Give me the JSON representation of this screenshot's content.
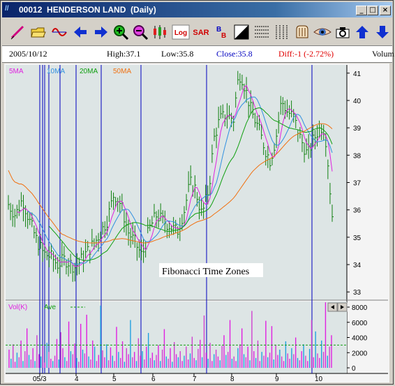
{
  "window": {
    "icon_text": "//",
    "title": "00012  HENDERSON LAND  (Daily)",
    "buttons": [
      "_",
      "□",
      "×"
    ]
  },
  "toolbar": [
    {
      "icon": "pen-icon"
    },
    {
      "icon": "open-folder-icon"
    },
    {
      "icon": "wave-icon"
    },
    {
      "icon": "arrow-left-icon"
    },
    {
      "icon": "arrow-right-icon"
    },
    {
      "icon": "zoom-in-icon"
    },
    {
      "icon": "zoom-out-icon"
    },
    {
      "icon": "candlestick-icon"
    },
    {
      "icon": "log-icon",
      "label": "Log"
    },
    {
      "icon": "sar-icon",
      "label": "SAR"
    },
    {
      "icon": "bollinger-icon",
      "label": "B"
    },
    {
      "icon": "contrast-icon"
    },
    {
      "icon": "grid-h-icon"
    },
    {
      "icon": "grid-v-icon"
    },
    {
      "icon": "stamp-icon"
    },
    {
      "icon": "eye-icon"
    },
    {
      "icon": "camera-icon"
    },
    {
      "icon": "arrow-up-icon"
    },
    {
      "icon": "arrow-down-icon"
    }
  ],
  "info": {
    "date": "2005/10/12",
    "high": "High:37.1",
    "low": "Low:35.8",
    "close": "Close:35.8",
    "diff": "Diff:-1  (-2.72%)",
    "volume": "Volum"
  },
  "colors": {
    "ma5": "#e020e0",
    "ma10": "#3090e0",
    "ma20": "#10a010",
    "ma50": "#f07010",
    "price": "#108010",
    "fib": "#0000c0",
    "chart_bg": "#dde5e5",
    "vol_avg": "#10a010"
  },
  "legend": [
    "5MA",
    "10MA",
    "20MA",
    "50MA"
  ],
  "annotation": "Fibonacci Time Zones",
  "vol_legend": {
    "label": "Vol(K)",
    "avg": "Ave"
  },
  "chart_data": [
    {
      "type": "line",
      "title": "00012 HENDERSON LAND (Daily)",
      "y_ticks": [
        "41",
        "40",
        "39",
        "38",
        "37",
        "36",
        "35",
        "34",
        "33"
      ],
      "ylim": [
        32.7,
        41.3
      ],
      "x_ticks": [
        "05/3",
        "4",
        "5",
        "6",
        "7",
        "8",
        "9",
        "10"
      ],
      "series": [
        {
          "name": "5MA"
        },
        {
          "name": "10MA"
        },
        {
          "name": "20MA"
        },
        {
          "name": "50MA"
        }
      ],
      "price_path": [
        [
          0,
          36.2
        ],
        [
          10,
          35.8
        ],
        [
          20,
          36.4
        ],
        [
          30,
          35.6
        ],
        [
          40,
          34.9
        ],
        [
          50,
          34.4
        ],
        [
          60,
          34.3
        ],
        [
          70,
          34.0
        ],
        [
          80,
          34.2
        ],
        [
          95,
          33.9
        ],
        [
          110,
          34.4
        ],
        [
          125,
          34.9
        ],
        [
          140,
          35.6
        ],
        [
          150,
          36.6
        ],
        [
          160,
          36.2
        ],
        [
          170,
          35.2
        ],
        [
          180,
          34.8
        ],
        [
          190,
          34.3
        ],
        [
          200,
          35.3
        ],
        [
          210,
          35.8
        ],
        [
          220,
          35.6
        ],
        [
          230,
          35.4
        ],
        [
          240,
          35.2
        ],
        [
          250,
          36.0
        ],
        [
          258,
          37.0
        ],
        [
          265,
          36.8
        ],
        [
          275,
          35.8
        ],
        [
          285,
          36.8
        ],
        [
          292,
          38.6
        ],
        [
          300,
          39.3
        ],
        [
          310,
          39.5
        ],
        [
          320,
          39.3
        ],
        [
          325,
          40.6
        ],
        [
          330,
          41.0
        ],
        [
          337,
          40.4
        ],
        [
          345,
          39.6
        ],
        [
          355,
          39.0
        ],
        [
          365,
          38.2
        ],
        [
          372,
          37.8
        ],
        [
          380,
          38.6
        ],
        [
          388,
          40.0
        ],
        [
          396,
          39.6
        ],
        [
          405,
          39.4
        ],
        [
          415,
          38.6
        ],
        [
          425,
          38.0
        ],
        [
          432,
          38.5
        ],
        [
          440,
          38.9
        ],
        [
          447,
          39.1
        ],
        [
          452,
          38.4
        ],
        [
          456,
          37.0
        ],
        [
          460,
          35.8
        ]
      ],
      "fib_zones_x": [
        51,
        55,
        58,
        64,
        80,
        103,
        139,
        196,
        290,
        441
      ]
    },
    {
      "type": "bar",
      "title": "Vol(K)",
      "y_ticks": [
        "8000",
        "6000",
        "4000",
        "2000",
        "0"
      ],
      "ylim": [
        0,
        8000
      ],
      "average": 3000,
      "values": [
        2400,
        1200,
        3100,
        800,
        2000,
        1400,
        3600,
        900,
        2200,
        5200,
        1700,
        1100,
        2600,
        900,
        4300,
        1800,
        1500,
        2900,
        700,
        3300,
        2100,
        1200,
        900,
        1600,
        3800,
        1100,
        4700,
        2600,
        1400,
        900,
        6100,
        2200,
        1800,
        3200,
        1300,
        800,
        5800,
        2400,
        1900,
        7000,
        1500,
        1100,
        3600,
        2800,
        900,
        1700,
        8200,
        2300,
        1400,
        3100,
        1000,
        2700,
        1600,
        900,
        5400,
        2100,
        1300,
        3500,
        800,
        2600,
        1800,
        6300,
        1400,
        2100,
        900,
        3900,
        1600,
        2200,
        1100,
        2800,
        4600,
        1300,
        2000,
        1000,
        1700,
        3000,
        900,
        2400,
        5100,
        1500,
        1200,
        2600,
        800,
        3400,
        1800,
        1400,
        2200,
        900,
        1600,
        2800,
        1100,
        1900,
        4100,
        1300,
        1000,
        2500,
        3700,
        1400,
        6900,
        2000,
        1200,
        3300,
        900,
        1800,
        2400,
        1500,
        1000,
        2900,
        4300,
        1700,
        2100,
        6300,
        1200,
        1500,
        900,
        2600,
        3100,
        5200,
        1800,
        1400,
        2800,
        1000,
        7500,
        2200,
        1300,
        3600,
        900,
        2100,
        1600,
        6200,
        1400,
        2000,
        5500,
        1100,
        3000,
        1700,
        2400,
        1500,
        900,
        3500,
        1900,
        1200,
        2600,
        1800,
        4000,
        1300,
        1000,
        2200,
        3100,
        1600,
        900,
        2500,
        6300,
        1400,
        4800,
        1900,
        1300,
        3600,
        2100,
        8800,
        1600,
        2800,
        4300
      ]
    }
  ]
}
